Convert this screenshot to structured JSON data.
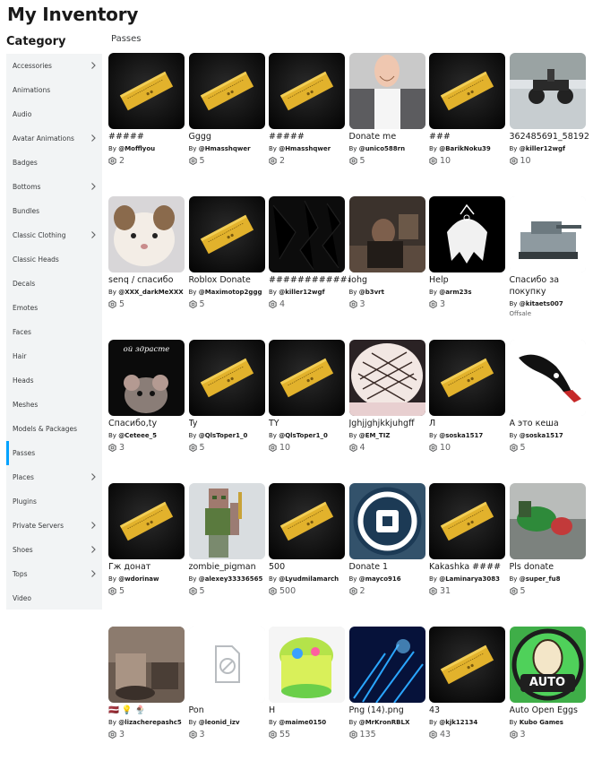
{
  "page": {
    "title": "My Inventory",
    "category_heading": "Category",
    "section_label": "Passes"
  },
  "sidebar": {
    "items": [
      {
        "label": "Accessories",
        "chevron": true
      },
      {
        "label": "Animations",
        "chevron": false
      },
      {
        "label": "Audio",
        "chevron": false
      },
      {
        "label": "Avatar Animations",
        "chevron": true
      },
      {
        "label": "Badges",
        "chevron": false
      },
      {
        "label": "Bottoms",
        "chevron": true
      },
      {
        "label": "Bundles",
        "chevron": false
      },
      {
        "label": "Classic Clothing",
        "chevron": true
      },
      {
        "label": "Classic Heads",
        "chevron": false
      },
      {
        "label": "Decals",
        "chevron": false
      },
      {
        "label": "Emotes",
        "chevron": false
      },
      {
        "label": "Faces",
        "chevron": false
      },
      {
        "label": "Hair",
        "chevron": false
      },
      {
        "label": "Heads",
        "chevron": false
      },
      {
        "label": "Meshes",
        "chevron": false
      },
      {
        "label": "Models & Packages",
        "chevron": false
      },
      {
        "label": "Passes",
        "chevron": false,
        "active": true
      },
      {
        "label": "Places",
        "chevron": true
      },
      {
        "label": "Plugins",
        "chevron": false
      },
      {
        "label": "Private Servers",
        "chevron": true
      },
      {
        "label": "Shoes",
        "chevron": true
      },
      {
        "label": "Tops",
        "chevron": true
      },
      {
        "label": "Video",
        "chevron": false
      }
    ]
  },
  "colors": {
    "accent": "#00a2ff",
    "sidebar_bg": "#f2f4f5",
    "ticket_gold": "#e2b22c"
  },
  "items": [
    {
      "name": "#####",
      "by": "By",
      "creator": "@Mofflyou",
      "price": "2",
      "thumb": "ticket"
    },
    {
      "name": "Gggg",
      "by": "By",
      "creator": "@Hmasshqwer",
      "price": "5",
      "thumb": "ticket"
    },
    {
      "name": "#####",
      "by": "By",
      "creator": "@Hmasshqwer",
      "price": "2",
      "thumb": "ticket"
    },
    {
      "name": "Donate me",
      "by": "By",
      "creator": "@unico588rn",
      "price": "5",
      "thumb": "avatar-photo"
    },
    {
      "name": "###",
      "by": "By",
      "creator": "@BarikNoku39",
      "price": "10",
      "thumb": "ticket"
    },
    {
      "name": "362485691_58192",
      "by": "By",
      "creator": "@killer12wgf",
      "price": "10",
      "thumb": "atv-photo"
    },
    {
      "name": "senq / спасибо",
      "by": "By",
      "creator": "@XXX_darkMeXXX",
      "price": "5",
      "thumb": "cat-photo"
    },
    {
      "name": "Roblox Donate",
      "by": "By",
      "creator": "@Maximotop2ggg",
      "price": "5",
      "thumb": "ticket"
    },
    {
      "name": "############",
      "by": "By",
      "creator": "@killer12wgf",
      "price": "4",
      "thumb": "dark-texture"
    },
    {
      "name": "iohg",
      "by": "By",
      "creator": "@b3vrt",
      "price": "3",
      "thumb": "dark-photo"
    },
    {
      "name": "Help",
      "by": "By",
      "creator": "@arm23s",
      "price": "3",
      "thumb": "bw-art"
    },
    {
      "name": "Спасибо за покупку",
      "by": "By",
      "creator": "@kitaets007",
      "price": "",
      "offsale": "Offsale",
      "thumb": "tank-photo"
    },
    {
      "name": "Спасибо,ty",
      "by": "By",
      "creator": "@Ceteee_5",
      "price": "3",
      "thumb": "mouse-photo",
      "overlay": "ой здрасте"
    },
    {
      "name": "Ty",
      "by": "By",
      "creator": "@QlsToper1_0",
      "price": "5",
      "thumb": "ticket"
    },
    {
      "name": "TY",
      "by": "By",
      "creator": "@QlsToper1_0",
      "price": "10",
      "thumb": "ticket"
    },
    {
      "name": "Jghjjghjkkjuhgff",
      "by": "By",
      "creator": "@EM_TIZ",
      "price": "4",
      "thumb": "cake-photo"
    },
    {
      "name": "Л",
      "by": "By",
      "creator": "@soska1517",
      "price": "10",
      "thumb": "ticket"
    },
    {
      "name": "А это кеша",
      "by": "By",
      "creator": "@soska1517",
      "price": "5",
      "thumb": "knife-art"
    },
    {
      "name": "Гж донат",
      "by": "By",
      "creator": "@wdorinaw",
      "price": "5",
      "thumb": "ticket"
    },
    {
      "name": "zombie_pigman",
      "by": "By",
      "creator": "@alexey33336565",
      "price": "5",
      "thumb": "pigman"
    },
    {
      "name": "500",
      "by": "By",
      "creator": "@Lyudmilamarch",
      "price": "500",
      "thumb": "ticket"
    },
    {
      "name": "Donate 1",
      "by": "By",
      "creator": "@mayco916",
      "price": "2",
      "thumb": "roblox-logo"
    },
    {
      "name": "Kakashka ####",
      "by": "By",
      "creator": "@Laminarya3083",
      "price": "31",
      "thumb": "ticket"
    },
    {
      "name": "Pls donate",
      "by": "By",
      "creator": "@super_fu8",
      "price": "5",
      "thumb": "green-photo"
    },
    {
      "name": "🇱🇻 💡 🍨",
      "by": "By",
      "creator": "@lizacherepashc5",
      "price": "3",
      "thumb": "room-photo"
    },
    {
      "name": "Pon",
      "by": "By",
      "creator": "@leonid_izv",
      "price": "3",
      "thumb": "missing"
    },
    {
      "name": "H",
      "by": "By",
      "creator": "@maime0150",
      "price": "55",
      "thumb": "slime-photo"
    },
    {
      "name": "Png (14).png",
      "by": "By",
      "creator": "@MrKronRBLX",
      "price": "135",
      "thumb": "blue-art"
    },
    {
      "name": "43",
      "by": "By",
      "creator": "@kjk12134",
      "price": "43",
      "thumb": "ticket"
    },
    {
      "name": "Auto Open Eggs",
      "by": "By",
      "creator": "Kubo Games",
      "price": "3",
      "thumb": "auto-egg",
      "overlay": "AUTO"
    }
  ]
}
